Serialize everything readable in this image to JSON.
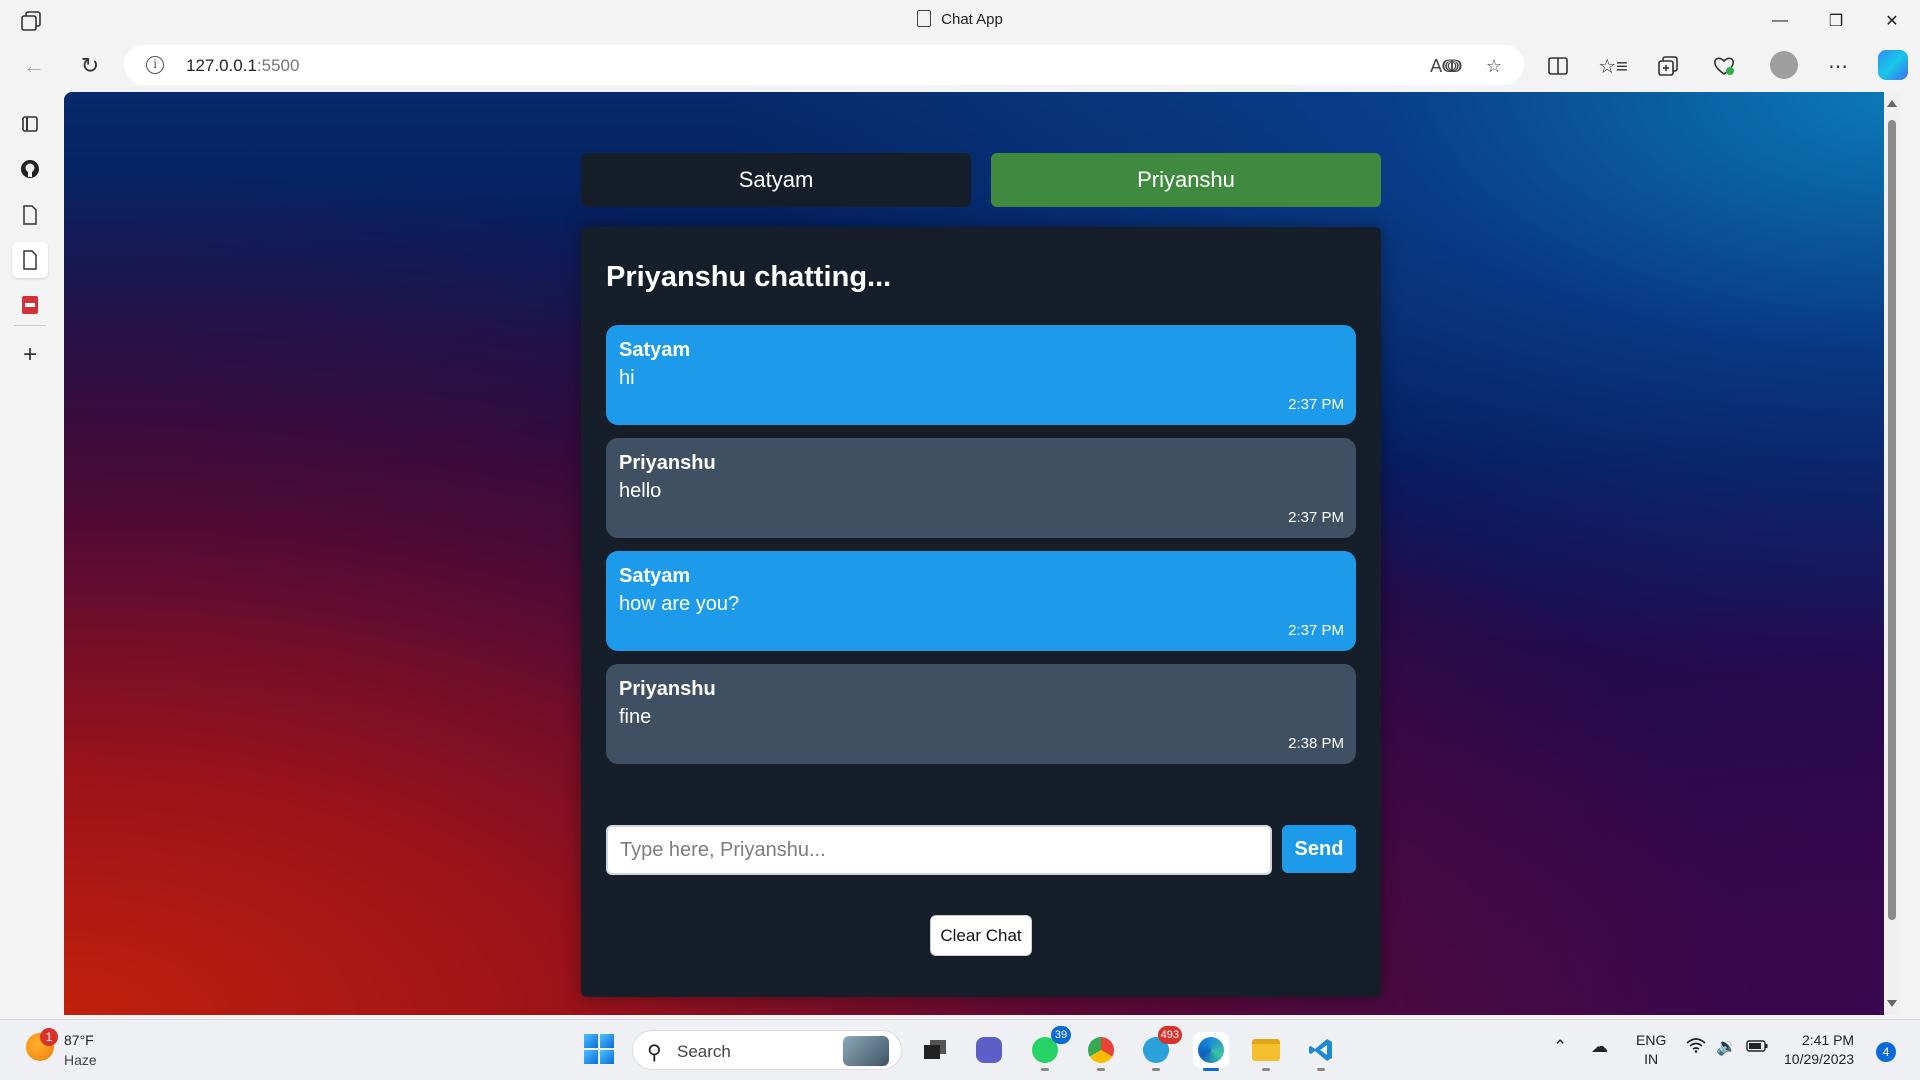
{
  "window": {
    "title": "Chat App"
  },
  "browser": {
    "url_host": "127.0.0.1",
    "url_port": ":5500"
  },
  "chat": {
    "users": [
      "Satyam",
      "Priyanshu"
    ],
    "active_user": "Priyanshu",
    "heading": "Priyanshu chatting...",
    "messages": [
      {
        "sender": "Satyam",
        "text": "hi",
        "time": "2:37 PM"
      },
      {
        "sender": "Priyanshu",
        "text": "hello",
        "time": "2:37 PM"
      },
      {
        "sender": "Satyam",
        "text": "how are you?",
        "time": "2:37 PM"
      },
      {
        "sender": "Priyanshu",
        "text": "fine",
        "time": "2:38 PM"
      }
    ],
    "input_placeholder": "Type here, Priyanshu...",
    "send_label": "Send",
    "clear_label": "Clear Chat"
  },
  "colors": {
    "panel_bg": "#161e29",
    "active_tab": "#3f8a3f",
    "message_blue": "#1d9bea",
    "message_gray": "#3f5063"
  },
  "taskbar": {
    "weather_temp": "87°F",
    "weather_desc": "Haze",
    "weather_badge": "1",
    "search_label": "Search",
    "whatsapp_badge": "39",
    "telegram_badge": "493",
    "lang_line1": "ENG",
    "lang_line2": "IN",
    "time": "2:41 PM",
    "date": "10/29/2023",
    "notifications": "4"
  },
  "icons": {
    "titlebar": [
      "workspaces-icon",
      "document-icon",
      "minimize-icon",
      "restore-icon",
      "close-icon"
    ],
    "toolbar": [
      "back-icon",
      "refresh-icon",
      "info-icon",
      "read-aloud-icon",
      "favorite-star-icon",
      "split-screen-icon",
      "favorites-icon",
      "collections-icon",
      "browser-essentials-icon",
      "profile-icon",
      "more-icon",
      "copilot-icon"
    ],
    "sidebar": [
      "tab-actions-icon",
      "github-icon",
      "document-icon",
      "document-icon",
      "pdf-icon",
      "add-icon"
    ]
  }
}
